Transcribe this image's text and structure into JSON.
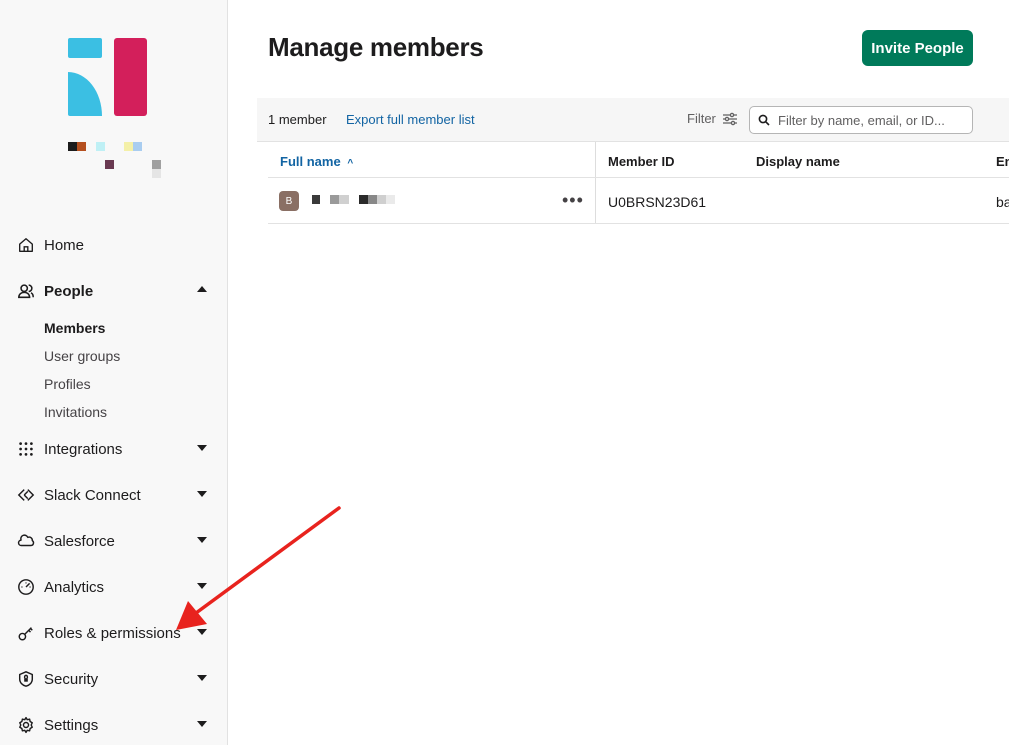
{
  "workspace": {
    "logo_colors": {
      "primary_blue": "#3bbfe3",
      "primary_red": "#d31f5b"
    }
  },
  "sidebar": {
    "items": [
      {
        "label": "Home",
        "icon": "home-icon"
      },
      {
        "label": "People",
        "icon": "people-icon",
        "expanded": true
      },
      {
        "label": "Integrations",
        "icon": "integrations-icon"
      },
      {
        "label": "Slack Connect",
        "icon": "slack-connect-icon"
      },
      {
        "label": "Salesforce",
        "icon": "salesforce-cloud-icon"
      },
      {
        "label": "Analytics",
        "icon": "analytics-gauge-icon"
      },
      {
        "label": "Roles & permissions",
        "icon": "key-icon"
      },
      {
        "label": "Security",
        "icon": "shield-icon"
      },
      {
        "label": "Settings",
        "icon": "gear-icon"
      }
    ],
    "people_sub": [
      {
        "label": "Members",
        "active": true
      },
      {
        "label": "User groups"
      },
      {
        "label": "Profiles"
      },
      {
        "label": "Invitations"
      }
    ]
  },
  "main": {
    "title": "Manage members",
    "invite_button": "Invite People",
    "toolbar": {
      "member_count": "1 member",
      "export_link": "Export full member list",
      "filter_label": "Filter",
      "search_placeholder": "Filter by name, email, or ID..."
    },
    "table": {
      "columns": [
        "Full name",
        "Member ID",
        "Display name",
        "Em"
      ],
      "sort_indicator": "^",
      "rows": [
        {
          "avatar_initial": "B",
          "member_id": "U0BRSN23D61",
          "display_name": "",
          "email_partial": "ba"
        }
      ]
    }
  },
  "colors": {
    "accent_green": "#007a5a",
    "link_blue": "#1264a3",
    "annotation_arrow": "#e8231e"
  }
}
